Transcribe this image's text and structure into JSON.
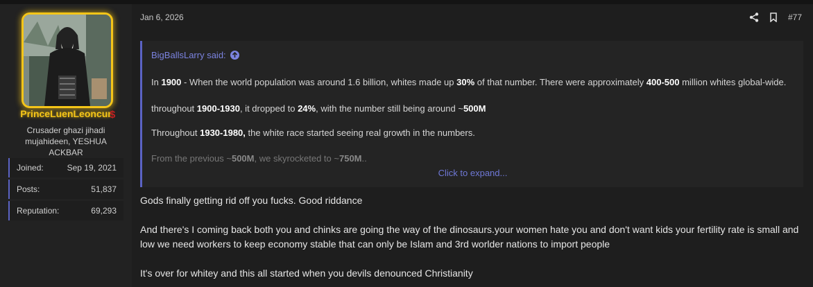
{
  "user": {
    "username": "PrinceLuenLeoncur",
    "title": "Crusader ghazi jihadi mujahideen, YESHUA ACKBAR",
    "stats": [
      {
        "label": "Joined:",
        "value": "Sep 19, 2021"
      },
      {
        "label": "Posts:",
        "value": "51,837"
      },
      {
        "label": "Reputation:",
        "value": "69,293"
      }
    ],
    "accent_color": "#f5c518"
  },
  "post": {
    "date": "Jan 6, 2026",
    "number": "#77",
    "icons": [
      "share-icon",
      "bookmark-icon"
    ],
    "quote": {
      "author": "BigBallsLarry said:",
      "expand_label": "Click to expand...",
      "p1": {
        "a": "In ",
        "b1": "1900",
        "c": " - When the world population was around 1.6 billion, whites made up ",
        "b2": "30%",
        "d": " of that number. There were approximately ",
        "b3": "400-500",
        "e": " million whites global-wide."
      },
      "p2": {
        "a": "throughout ",
        "b1": "1900-1930",
        "c": ", it dropped to ",
        "b2": "24%",
        "d": ", with the number still being around ~",
        "b3": "500M"
      },
      "p3": {
        "a": "Throughout ",
        "b1": "1930-1980,",
        "c": " the white race started seeing real growth in the numbers."
      },
      "p4": {
        "a": "From the previous ~",
        "b1": "500M",
        "c": ", we skyrocketed to ~",
        "b2": "750M",
        "d": ".."
      }
    },
    "messages": [
      "Gods finally getting rid off you fucks. Good riddance",
      "And there's I coming back both you and chinks are going the way of the dinosaurs.your women hate you and don't want kids your fertility rate is small and low we need workers to keep economy stable that can only be Islam and 3rd worlder nations to import people",
      "It's over for whitey and this all started when you devils denounced Christianity"
    ],
    "link_color": "#7b83e0"
  }
}
